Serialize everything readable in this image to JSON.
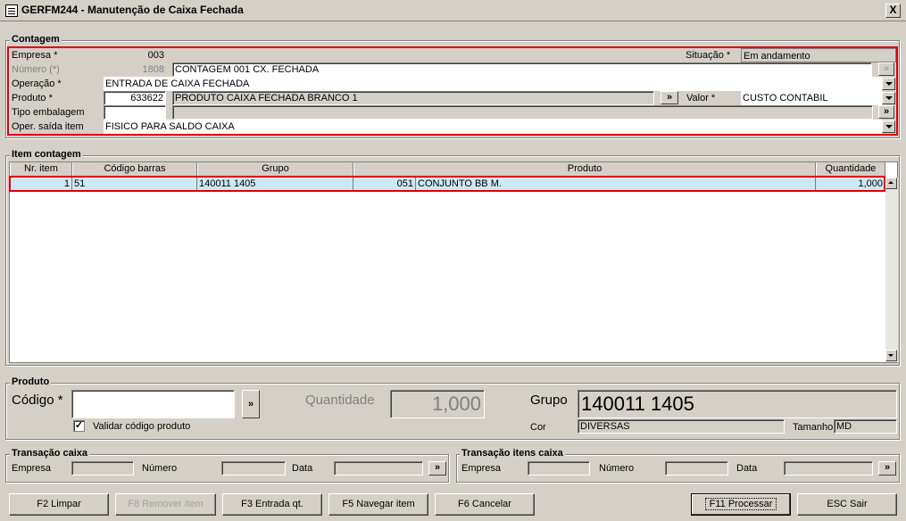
{
  "window": {
    "title": "GERFM244 - Manutenção de Caixa Fechada",
    "close_label": "X"
  },
  "contagem": {
    "legend": "Contagem",
    "empresa_label": "Empresa *",
    "empresa_value": "003",
    "situacao_label": "Situação *",
    "situacao_value": "Em andamento",
    "numero_label": "Número (*)",
    "numero_value": "1808",
    "numero_desc": "CONTAGEM 001 CX. FECHADA",
    "operacao_label": "Operação *",
    "operacao_value": "ENTRADA DE CAIXA FECHADA",
    "produto_label": "Produto *",
    "produto_code": "633622",
    "produto_desc": "PRODUTO CAIXA FECHADA BRANCO 1",
    "valor_label": "Valor *",
    "valor_value": "CUSTO CONTABIL",
    "tipo_label": "Tipo embalagem",
    "tipo_value": "",
    "oper_saida_label": "Oper. saída item",
    "oper_saida_value": "FISICO PARA SALDO CAIXA",
    "lookup_label": "»"
  },
  "item_contagem": {
    "legend": "Item contagem",
    "columns": [
      "Nr. item",
      "Código barras",
      "Grupo",
      "Produto",
      "Quantidade"
    ],
    "rows": [
      {
        "nr_item": "1",
        "codigo_barras": "51",
        "grupo": "140011 1405",
        "produto_code": "051",
        "produto_desc": "CONJUNTO BB M.",
        "quantidade": "1,000"
      }
    ]
  },
  "produto": {
    "legend": "Produto",
    "codigo_label": "Código *",
    "codigo_value": "",
    "quantidade_label": "Quantidade",
    "quantidade_value": "1,000",
    "grupo_label": "Grupo",
    "grupo_value": "140011 1405",
    "cor_label": "Cor",
    "cor_value": "DIVERSAS",
    "tamanho_label": "Tamanho",
    "tamanho_value": "MD",
    "validar_label": "Validar código produto",
    "validar_checked": "✓",
    "lookup_label": "»"
  },
  "transacao_caixa": {
    "legend": "Transação caixa",
    "empresa_label": "Empresa",
    "numero_label": "Número",
    "data_label": "Data",
    "lookup_label": "»"
  },
  "transacao_itens": {
    "legend": "Transação itens caixa",
    "empresa_label": "Empresa",
    "numero_label": "Número",
    "data_label": "Data",
    "lookup_label": "»"
  },
  "buttons": {
    "limpar": "F2 Limpar",
    "remover": "F8 Remover item",
    "entrada": "F3 Entrada qt.",
    "navegar": "F5 Navegar item",
    "cancelar": "F6 Cancelar",
    "processar": "F11 Processar",
    "sair": "ESC Sair"
  }
}
